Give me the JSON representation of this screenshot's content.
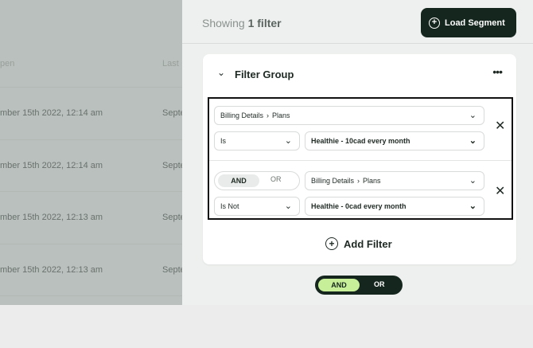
{
  "table": {
    "columns": [
      "pen",
      "Last"
    ],
    "rows": [
      {
        "date": "mber 15th 2022, 12:14 am",
        "next": "Septe"
      },
      {
        "date": "mber 15th 2022, 12:14 am",
        "next": "Septe"
      },
      {
        "date": "mber 15th 2022, 12:13 am",
        "next": "Septe"
      },
      {
        "date": "mber 15th 2022, 12:13 am",
        "next": "Septe"
      }
    ]
  },
  "drawer": {
    "showing_prefix": "Showing",
    "showing_count": "1 filter",
    "load_segment_label": "Load Segment",
    "filter_group_title": "Filter Group",
    "more_label": "•••",
    "filters": [
      {
        "property": "Billing Details",
        "property_sub": "Plans",
        "operator": "Is",
        "value": "Healthie - 10cad every month"
      },
      {
        "connector_on": "AND",
        "connector_off": "OR",
        "property": "Billing Details",
        "property_sub": "Plans",
        "operator": "Is Not",
        "value": "Healthie - 0cad every month"
      }
    ],
    "add_filter_label": "Add Filter",
    "group_connector_on": "AND",
    "group_connector_off": "OR"
  },
  "colors": {
    "dark_green": "#14261d",
    "accent_lime": "#c7ef9a"
  }
}
